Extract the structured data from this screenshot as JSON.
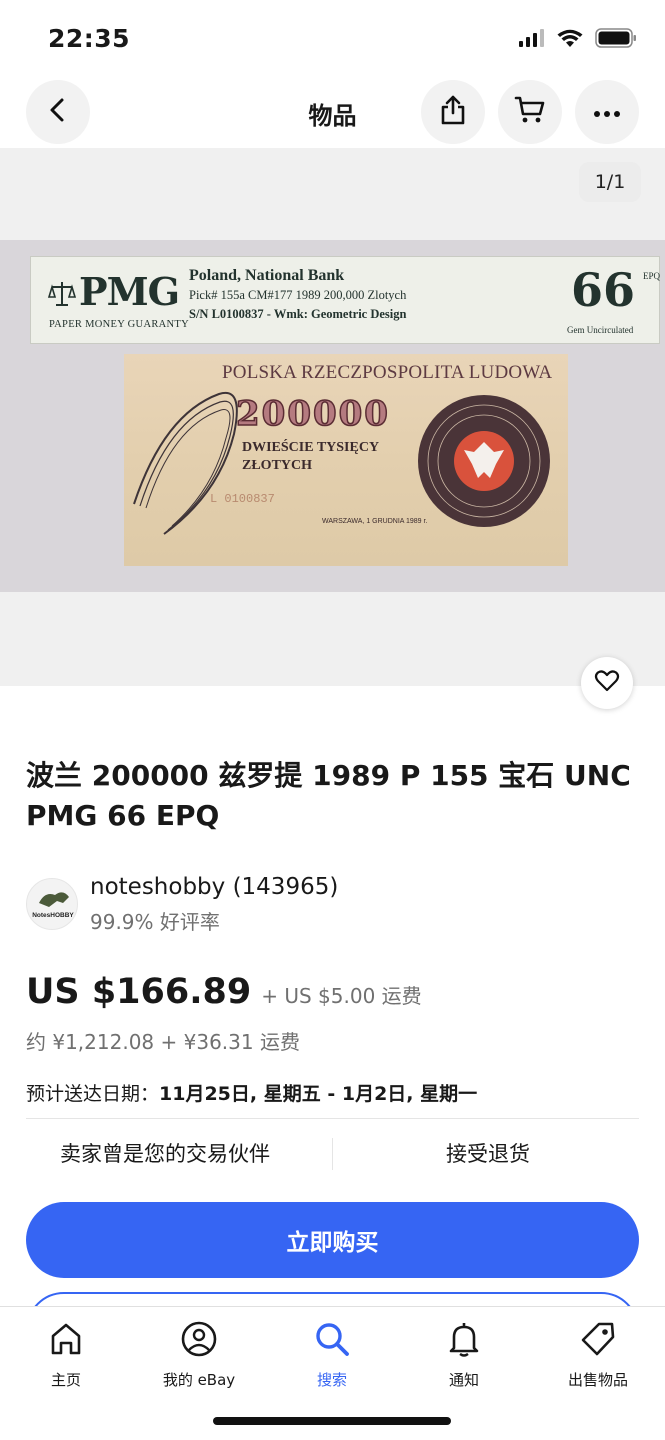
{
  "status_bar": {
    "time": "22:35",
    "icons": [
      "cellular-signal-icon",
      "wifi-icon",
      "battery-icon"
    ]
  },
  "topbar": {
    "title": "物品",
    "back_icon": "chevron-left-icon",
    "share_icon": "share-icon",
    "cart_icon": "cart-icon",
    "more_icon": "more-horizontal-icon"
  },
  "gallery": {
    "counter": "1/1",
    "image_description_text": {
      "pmg_logo": "PMG",
      "pmg_sub": "PAPER MONEY GUARANTY",
      "label_line1": "Poland, National Bank",
      "label_line2": "Pick# 155a  CM#177    1989  200,000 Zlotych",
      "label_line3": "S/N L0100837 - Wmk: Geometric Design",
      "grade": "66",
      "grade_letters": "EPQ",
      "grade_text": "Gem Uncirculated",
      "note_header": "POLSKA RZECZPOSPOLITA LUDOWA",
      "note_value": "200000",
      "note_line1": "DWIEŚCIE TYSIĘCY",
      "note_line2": "ZŁOTYCH",
      "note_serial": "L 0100837",
      "note_city": "WARSZAWA, 1 GRUDNIA 1989 r."
    }
  },
  "favorite_icon": "heart-icon",
  "listing": {
    "title": "波兰 200000 兹罗提 1989 P 155 宝石 UNC PMG 66 EPQ",
    "seller_avatar_text": "NotesHOBBY",
    "seller_name": "noteshobby (143965)",
    "seller_rating": "99.9% 好评率",
    "price": "US $166.89",
    "shipping": "+ US $5.00 运费",
    "approx": "约 ¥1,212.08 + ¥36.31 运费",
    "delivery_label": "预计送达日期：",
    "delivery_value": "11月25日, 星期五 - 1月2日, 星期一",
    "feature_left": "卖家曾是您的交易伙伴",
    "feature_right": "接受退货",
    "buy_now": "立即购买"
  },
  "tabbar": {
    "items": [
      {
        "label": "主页",
        "icon": "home-icon",
        "active": false
      },
      {
        "label": "我的 eBay",
        "icon": "user-circle-icon",
        "active": false
      },
      {
        "label": "搜索",
        "icon": "search-icon",
        "active": true
      },
      {
        "label": "通知",
        "icon": "bell-icon",
        "active": false
      },
      {
        "label": "出售物品",
        "icon": "tag-icon",
        "active": false
      }
    ]
  },
  "colors": {
    "accent": "#3665f3",
    "text": "#191919",
    "secondary_text": "#707070",
    "gallery_bg": "#f0f0f0"
  }
}
